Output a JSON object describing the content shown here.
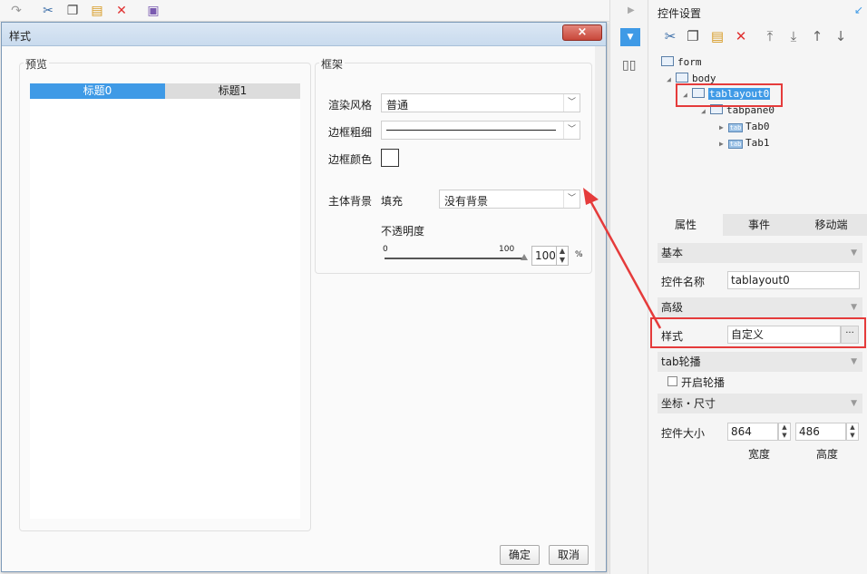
{
  "dialog": {
    "title": "样式",
    "close_symbol": "×",
    "preview": {
      "label": "预览",
      "tabs": [
        "标题0",
        "标题1"
      ]
    },
    "frame": {
      "label": "框架",
      "render_style_label": "渲染风格",
      "render_style_value": "普通",
      "border_width_label": "边框粗细",
      "border_color_label": "边框颜色",
      "body_bg_label": "主体背景",
      "fill_label": "填充",
      "fill_value": "没有背景",
      "opacity_label": "不透明度",
      "slider_min": "0",
      "slider_max": "100",
      "opacity_value": "100",
      "opacity_unit": "%"
    },
    "ok_label": "确定",
    "cancel_label": "取消"
  },
  "right_panel": {
    "title": "控件设置",
    "tree": {
      "form": "form",
      "body": "body",
      "tablayout": "tablayout0",
      "tabpane": "tabpane0",
      "tab0": "Tab0",
      "tab1": "Tab1",
      "tab_icon_text": "tab"
    },
    "tabs": [
      "属性",
      "事件",
      "移动端"
    ],
    "sections": {
      "basic": "基本",
      "advanced": "高级",
      "tab_carousel": "tab轮播",
      "coord_size": "坐标・尺寸"
    },
    "fields": {
      "widget_name_label": "控件名称",
      "widget_name_value": "tablayout0",
      "style_label": "样式",
      "style_value": "自定义",
      "style_more": "···",
      "carousel_label": "开启轮播",
      "size_label": "控件大小",
      "width_value": "864",
      "height_value": "486",
      "width_caption": "宽度",
      "height_caption": "高度"
    }
  },
  "colors": {
    "accent": "#3f9ae6",
    "highlight": "#e53b3b",
    "close": "#c8473a"
  }
}
